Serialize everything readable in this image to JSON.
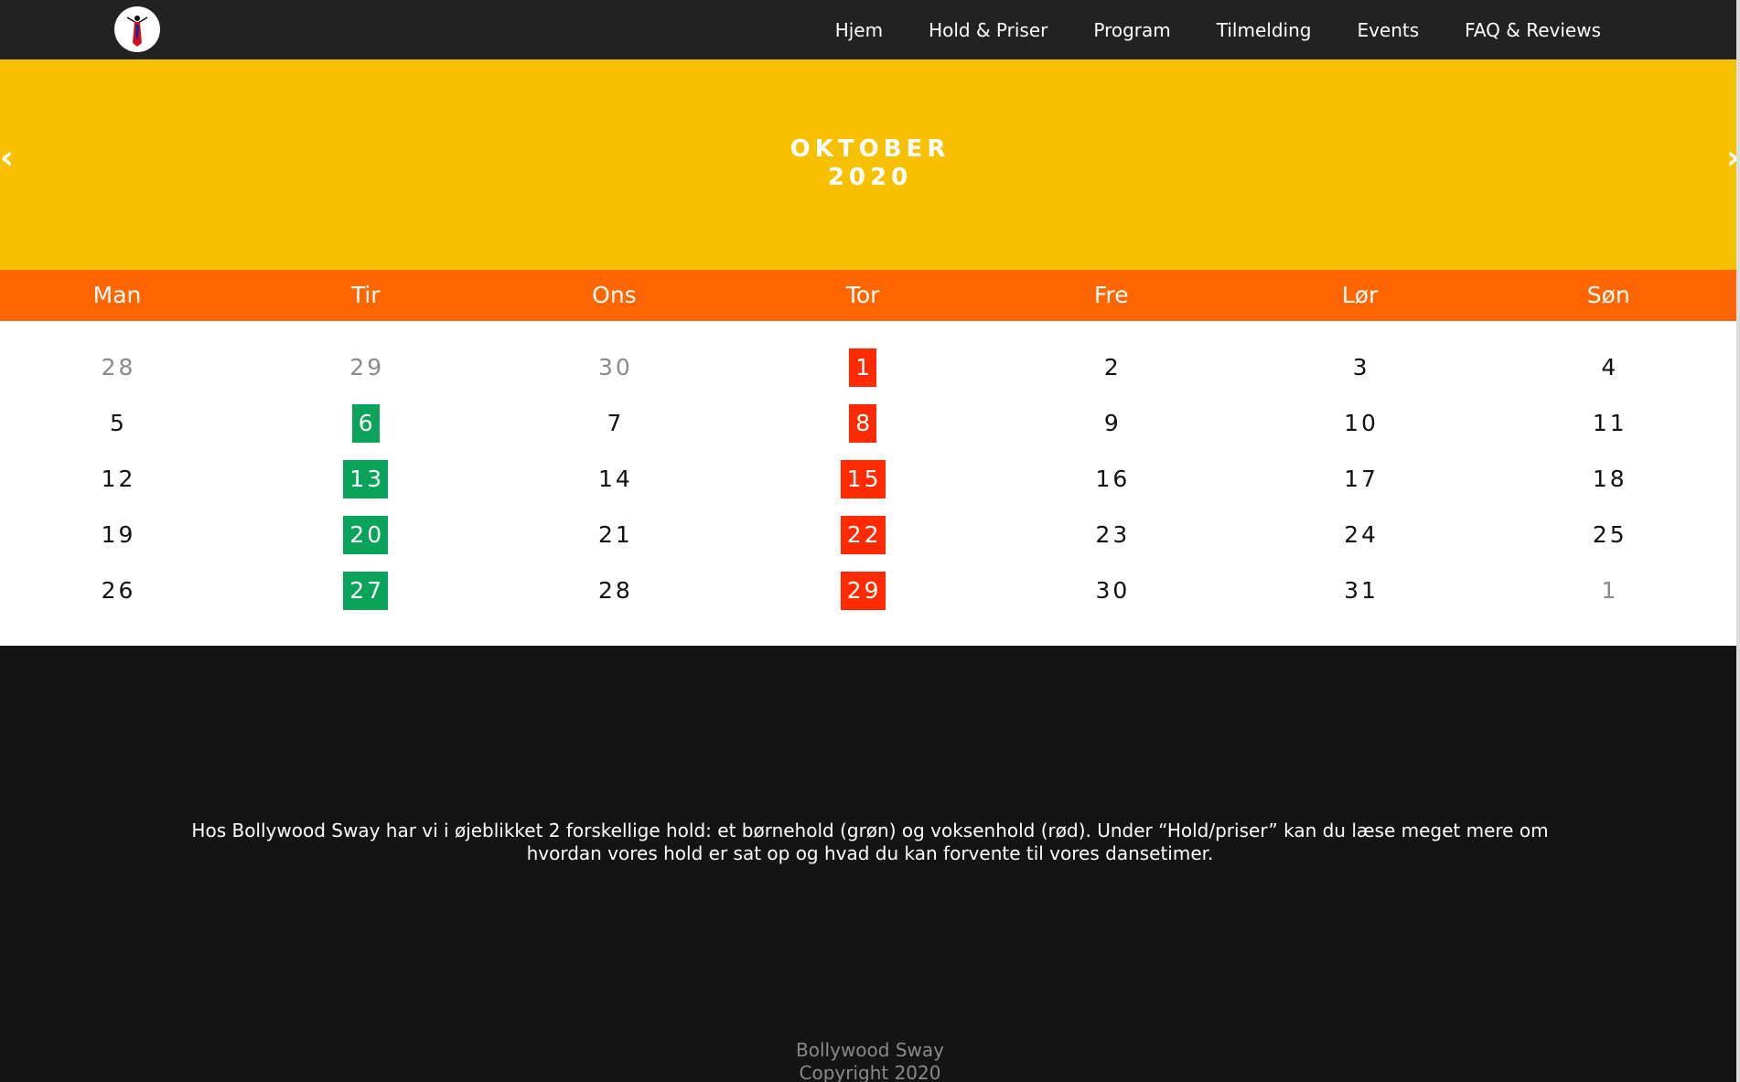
{
  "nav": {
    "logo": "logo",
    "items": [
      "Hjem",
      "Hold & Priser",
      "Program",
      "Tilmelding",
      "Events",
      "FAQ & Reviews"
    ]
  },
  "calendar": {
    "month": "OKTOBER",
    "year": "2020",
    "prev_icon": "‹",
    "next_icon": "›",
    "weekdays": [
      "Man",
      "Tir",
      "Ons",
      "Tor",
      "Fre",
      "Lør",
      "Søn"
    ],
    "weeks": [
      [
        {
          "label": "28",
          "kind": "other"
        },
        {
          "label": "29",
          "kind": "other"
        },
        {
          "label": "30",
          "kind": "other"
        },
        {
          "label": "1",
          "kind": "red"
        },
        {
          "label": "2",
          "kind": "normal"
        },
        {
          "label": "3",
          "kind": "normal"
        },
        {
          "label": "4",
          "kind": "normal"
        }
      ],
      [
        {
          "label": "5",
          "kind": "normal"
        },
        {
          "label": "6",
          "kind": "green"
        },
        {
          "label": "7",
          "kind": "normal"
        },
        {
          "label": "8",
          "kind": "red"
        },
        {
          "label": "9",
          "kind": "normal"
        },
        {
          "label": "10",
          "kind": "normal"
        },
        {
          "label": "11",
          "kind": "normal"
        }
      ],
      [
        {
          "label": "12",
          "kind": "normal"
        },
        {
          "label": "13",
          "kind": "green"
        },
        {
          "label": "14",
          "kind": "normal"
        },
        {
          "label": "15",
          "kind": "red"
        },
        {
          "label": "16",
          "kind": "normal"
        },
        {
          "label": "17",
          "kind": "normal"
        },
        {
          "label": "18",
          "kind": "normal"
        }
      ],
      [
        {
          "label": "19",
          "kind": "normal"
        },
        {
          "label": "20",
          "kind": "green"
        },
        {
          "label": "21",
          "kind": "normal"
        },
        {
          "label": "22",
          "kind": "red"
        },
        {
          "label": "23",
          "kind": "normal"
        },
        {
          "label": "24",
          "kind": "normal"
        },
        {
          "label": "25",
          "kind": "normal"
        }
      ],
      [
        {
          "label": "26",
          "kind": "normal"
        },
        {
          "label": "27",
          "kind": "green"
        },
        {
          "label": "28",
          "kind": "normal"
        },
        {
          "label": "29",
          "kind": "red"
        },
        {
          "label": "30",
          "kind": "normal"
        },
        {
          "label": "31",
          "kind": "normal"
        },
        {
          "label": "1",
          "kind": "other"
        }
      ]
    ]
  },
  "info": {
    "line1": "Hos Bollywood Sway har vi i øjeblikket 2 forskellige hold: et børnehold (grøn) og voksenhold (rød). Under “Hold/priser” kan du læse meget mere om",
    "line2": "hvordan vores hold er sat op og hvad du kan forvente til vores dansetimer."
  },
  "footer": {
    "name": "Bollywood Sway",
    "copyright": "Copyright 2020"
  },
  "colors": {
    "navbar": "#222222",
    "banner": "#f7c000",
    "weekday_bar": "#ff6600",
    "kids_class": "#0aa35a",
    "adult_class": "#ff2a00"
  }
}
